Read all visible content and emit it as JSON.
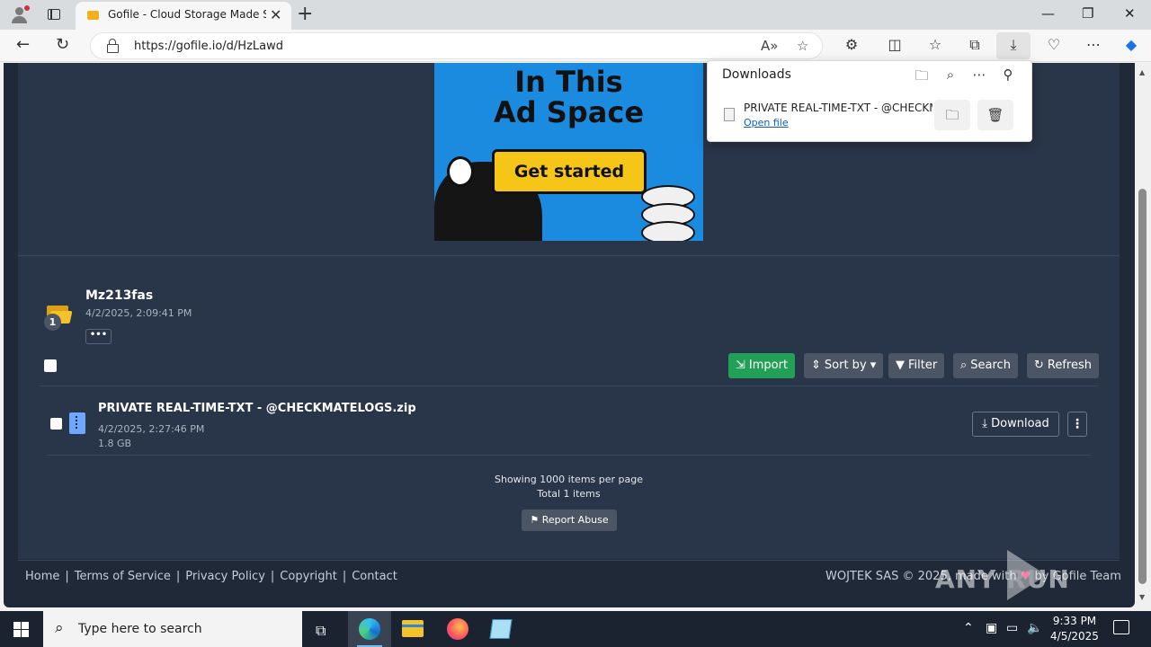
{
  "browser": {
    "tab_title": "Gofile - Cloud Storage Made Simple",
    "tab_close": "✕",
    "new_tab": "+",
    "url": "https://gofile.io/d/HzLawd",
    "window_controls": [
      "—",
      "❐",
      "✕"
    ]
  },
  "ad": {
    "line1": "In This",
    "line2": "Ad Space",
    "cta": "Get started"
  },
  "folder": {
    "badge": "1",
    "name": "Mz213fas",
    "date": "4/2/2025, 2:09:41 PM",
    "more": "•••"
  },
  "toolbar": {
    "import": "Import",
    "sort": "Sort by",
    "filter": "Filter",
    "search": "Search",
    "refresh": "Refresh"
  },
  "file": {
    "name": "PRIVATE REAL-TIME-TXT - @CHECKMATELOGS.zip",
    "date": "4/2/2025, 2:27:46 PM",
    "size": "1.8 GB",
    "download": "Download",
    "more": "⋮"
  },
  "pagination": {
    "showing": "Showing 1000 items per page",
    "total": "Total 1 items",
    "report": "Report Abuse"
  },
  "footer": {
    "links": [
      "Home",
      "Terms of Service",
      "Privacy Policy",
      "Copyright",
      "Contact"
    ],
    "copyright_prefix": "WOJTEK SAS © 2025, made with",
    "copyright_suffix": "by Gofile Team"
  },
  "watermark": "ANY RUN",
  "downloads_panel": {
    "title": "Downloads",
    "file_name": "PRIVATE REAL-TIME-TXT - @CHECKMATELOGS.zip",
    "open_link": "Open file"
  },
  "taskbar": {
    "search_placeholder": "Type here to search",
    "time": "9:33 PM",
    "date": "4/5/2025"
  },
  "colors": {
    "page_bg": "#1f2937",
    "panel_bg": "#293548",
    "import_green": "#22a055",
    "button_grey": "#4b5563",
    "ad_blue": "#1b8be0",
    "cta_yellow": "#f5c518"
  }
}
